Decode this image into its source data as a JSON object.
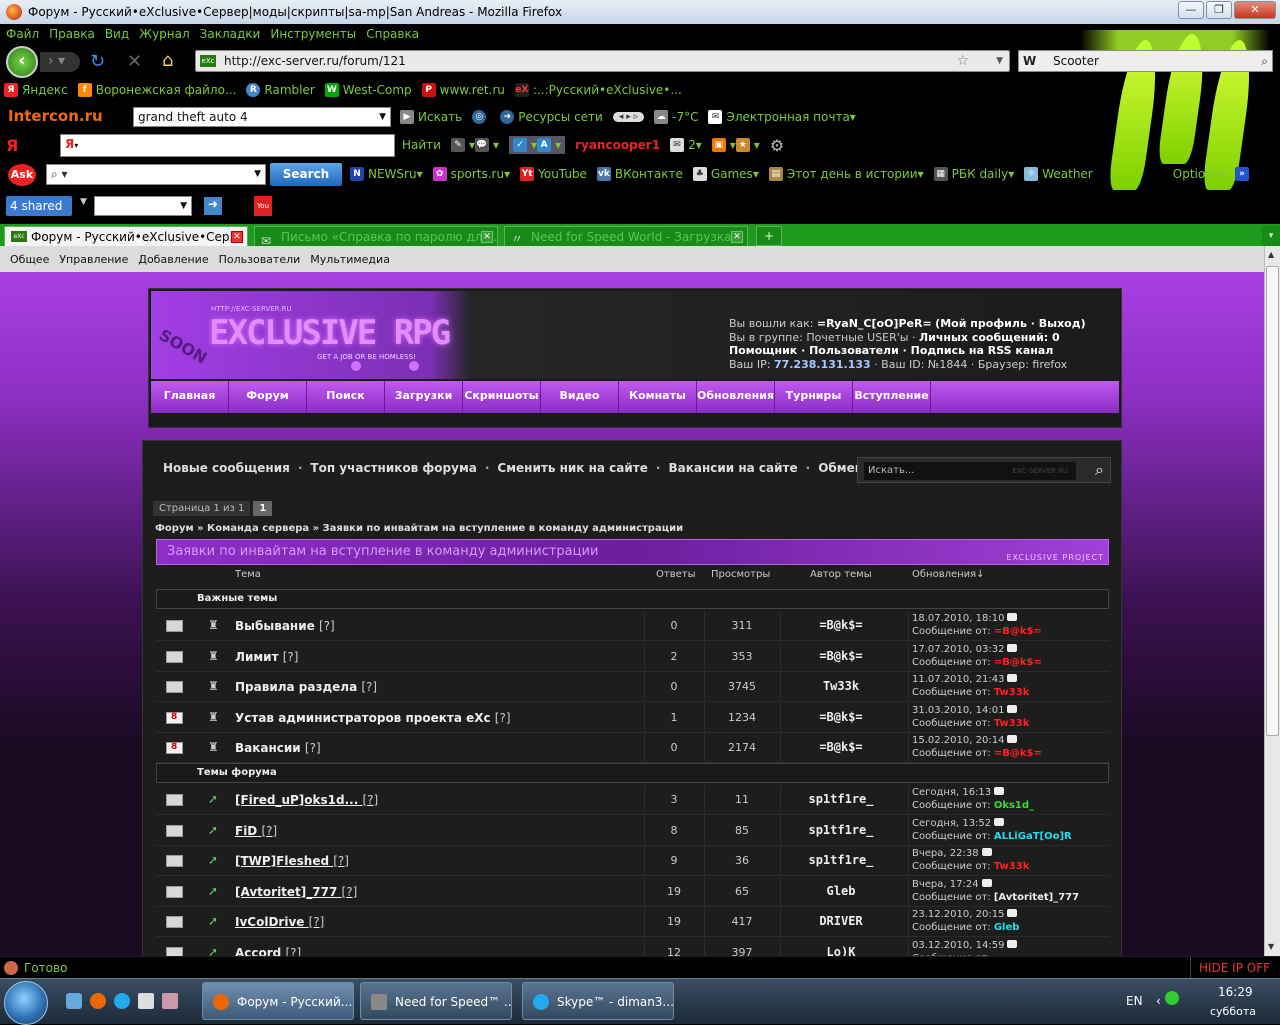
{
  "window": {
    "title": "Форум - Русский•eXclusive•Сервер|моды|скрипты|sa-mp|San Andreas - Mozilla Firefox"
  },
  "menu": [
    "Файл",
    "Правка",
    "Вид",
    "Журнал",
    "Закладки",
    "Инструменты",
    "Справка"
  ],
  "nav": {
    "url": "http://exc-server.ru/forum/121",
    "search_engine": "W",
    "search_value": "Scooter"
  },
  "bookmarks": [
    "Яндекс",
    "Воронежская файло...",
    "Rambler",
    "West-Comp",
    "www.ret.ru",
    ":..:Русский•eXclusive•..."
  ],
  "intercon": {
    "brand": "Intercon.ru",
    "query": "grand theft auto 4",
    "search": "Искать",
    "network": "Ресурсы сети",
    "temp": "-7°C",
    "mail": "Электронная почта"
  },
  "yandex": {
    "find": "Найти",
    "user": "ryancooper1",
    "mail_count": "2"
  },
  "ask": {
    "search_btn": "Search",
    "links": [
      "NEWSru",
      "sports.ru",
      "YouTube",
      "ВКонтакте",
      "Games",
      "Этот день в истории",
      "РБК daily",
      "Weather"
    ],
    "options": "Options"
  },
  "shared": {
    "label": "shared"
  },
  "tabs": [
    "Форум - Русский•eXclusive•Сер...",
    "Письмо «Справка по паролю для ...",
    "Need for Speed World - Загрузка"
  ],
  "adminbar": [
    "Общее",
    "Управление",
    "Добавление",
    "Пользователи",
    "Мультимедиа"
  ],
  "site": {
    "logo": "EXCLUSIVE RPG",
    "logo_url": "HTTP://EXC-SERVER.RU",
    "tagline": "GET A JOB OR BE HOMLESS!",
    "soon": "SOON",
    "user_line1": "Вы вошли как: ",
    "user_name": "=RyaN_C[oO]PeR=",
    "user_links": "(Мой профиль · Выход)",
    "group_line": "Вы в группе: Почетные USER'ы · ",
    "messages": "Личных сообщений: 0",
    "links_line": "Помощник · Пользователи · Подпись на RSS канал",
    "ip_label": "Ваш IP: ",
    "ip": "77.238.131.133",
    "id_line": " · Ваш ID: №1844 · Браузер: firefox",
    "nav": [
      "Главная",
      "Форум",
      "Поиск",
      "Загрузки",
      "Скриншоты",
      "Видео",
      "Комнаты",
      "Обновления",
      "Турниры",
      "Вступление"
    ]
  },
  "forum": {
    "toplinks": [
      "Новые сообщения",
      "Топ участников форума",
      "Сменить ник на сайте",
      "Вакансии на сайте",
      "Обмен баннерами"
    ],
    "search_placeholder": "Искать...",
    "search_watermark": "EXC-SERVER.RU",
    "pager_label": "Страница 1 из 1",
    "pager_num": "1",
    "crumbs": "Форум » Команда сервера » Заявки по инвайтам на вступление в команду администрации",
    "heading": "Заявки по инвайтам на вступление в команду администрации",
    "heading_tag": "EXCLUSIVE PROJECT",
    "cols": {
      "topic": "Тема",
      "replies": "Ответы",
      "views": "Просмотры",
      "author": "Автор темы",
      "updates": "Обновления↓"
    },
    "sections": {
      "important": "Важные темы",
      "topics": "Темы форума"
    },
    "important_rows": [
      {
        "title": "Выбывание",
        "q": "[?]",
        "replies": "0",
        "views": "311",
        "author": "=B@k$=",
        "date": "18.07.2010, 18:10",
        "by_label": "Сообщение от: ",
        "by": "=B@k$=",
        "by_color": "#ff2020",
        "env": "plain"
      },
      {
        "title": "Лимит",
        "q": "[?]",
        "replies": "2",
        "views": "353",
        "author": "=B@k$=",
        "date": "17.07.2010, 03:32",
        "by_label": "Сообщение от: ",
        "by": "=B@k$=",
        "by_color": "#ff2020",
        "env": "plain"
      },
      {
        "title": "Правила раздела",
        "q": "[?]",
        "replies": "0",
        "views": "3745",
        "author": "Tw33k",
        "date": "11.07.2010, 21:43",
        "by_label": "Сообщение от: ",
        "by": "Tw33k",
        "by_color": "#ff2020",
        "env": "plain"
      },
      {
        "title": "Устав администраторов проекта eXc",
        "q": "[?]",
        "replies": "1",
        "views": "1234",
        "author": "=B@k$=",
        "date": "31.03.2010, 14:01",
        "by_label": "Сообщение от: ",
        "by": "Tw33k",
        "by_color": "#ff2020",
        "env": "red"
      },
      {
        "title": "Вакансии",
        "q": "[?]",
        "replies": "0",
        "views": "2174",
        "author": "=B@k$=",
        "date": "15.02.2010, 20:14",
        "by_label": "Сообщение от: ",
        "by": "=B@k$=",
        "by_color": "#ff2020",
        "env": "red"
      }
    ],
    "topic_rows": [
      {
        "title": "[Fired_uP]oks1d...",
        "q": "[?]",
        "replies": "3",
        "views": "11",
        "author": "sp1tf1re_",
        "date": "Сегодня, 16:13",
        "by_label": "Сообщение от: ",
        "by": "Oks1d_",
        "by_color": "#33dd33"
      },
      {
        "title": "FiD",
        "q": "[?]",
        "replies": "8",
        "views": "85",
        "author": "sp1tf1re_",
        "date": "Сегодня, 13:52",
        "by_label": "Сообщение от: ",
        "by": "ALLiGaT[Oo]R",
        "by_color": "#22ddee"
      },
      {
        "title": "[TWP]Fleshed",
        "q": "[?]",
        "replies": "9",
        "views": "36",
        "author": "sp1tf1re_",
        "date": "Вчера, 22:38",
        "by_label": "Сообщение от: ",
        "by": "Tw33k",
        "by_color": "#ff2020"
      },
      {
        "title": "[Avtoritet]_777",
        "q": "[?]",
        "replies": "19",
        "views": "65",
        "author": "Gleb",
        "date": "Вчера, 17:24",
        "by_label": "Сообщение от: ",
        "by": "[Avtoritet]_777",
        "by_color": "#eeeeee"
      },
      {
        "title": "IvColDrive",
        "q": "[?]",
        "replies": "19",
        "views": "417",
        "author": "DRIVER",
        "date": "23.12.2010, 20:15",
        "by_label": "Сообщение от: ",
        "by": "Gleb",
        "by_color": "#22ddee"
      },
      {
        "title": "Accord",
        "q": "[?]",
        "replies": "12",
        "views": "397",
        "author": "Lo)K",
        "date": "03.12.2010, 14:59",
        "by_label": "Сообщение от: ",
        "by": "",
        "by_color": "#eeeeee"
      }
    ]
  },
  "status": {
    "text": "Готово",
    "hide_ip": "HIDE IP OFF"
  },
  "taskbar": {
    "items": [
      "Форум - Русский...",
      "Need for Speed™ ...",
      "Skype™ - diman3..."
    ],
    "lang": "EN",
    "time": "16:29",
    "day": "суббота"
  }
}
